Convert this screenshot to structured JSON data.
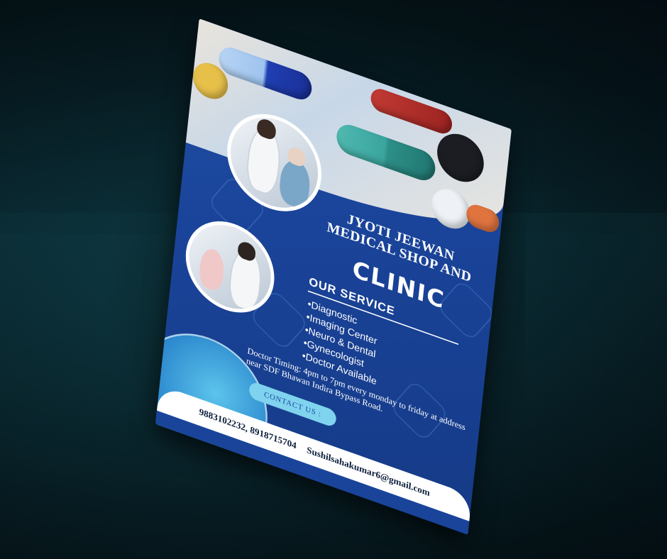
{
  "flyer": {
    "title_line1": "JYOTI JEEWAN",
    "title_line2": "MEDICAL SHOP AND",
    "title_main": "CLINIC",
    "services_heading": "OUR SERVICE",
    "services": [
      "Diagnostic",
      "Imaging Center",
      "Neuro & Dental",
      "Gynecologist",
      "Doctor Available"
    ],
    "timing_text": "Doctor Timing: 4pm to 7pm every monday to friday at address near SDF Bhawan Indira Bypass Road.",
    "contact_label": "CONTACT US :",
    "phones": "9883102232, 8918715704",
    "email": "Sushilsahakumar6@gmail.com"
  },
  "colors": {
    "flyer_blue": "#1a449a",
    "accent_cyan": "#7fd3ee",
    "background": "#0a2a33"
  },
  "icons": [
    "medical-hex-pattern-icon",
    "capsule-pill-image",
    "doctor-photo",
    "child-doctor-photo"
  ]
}
